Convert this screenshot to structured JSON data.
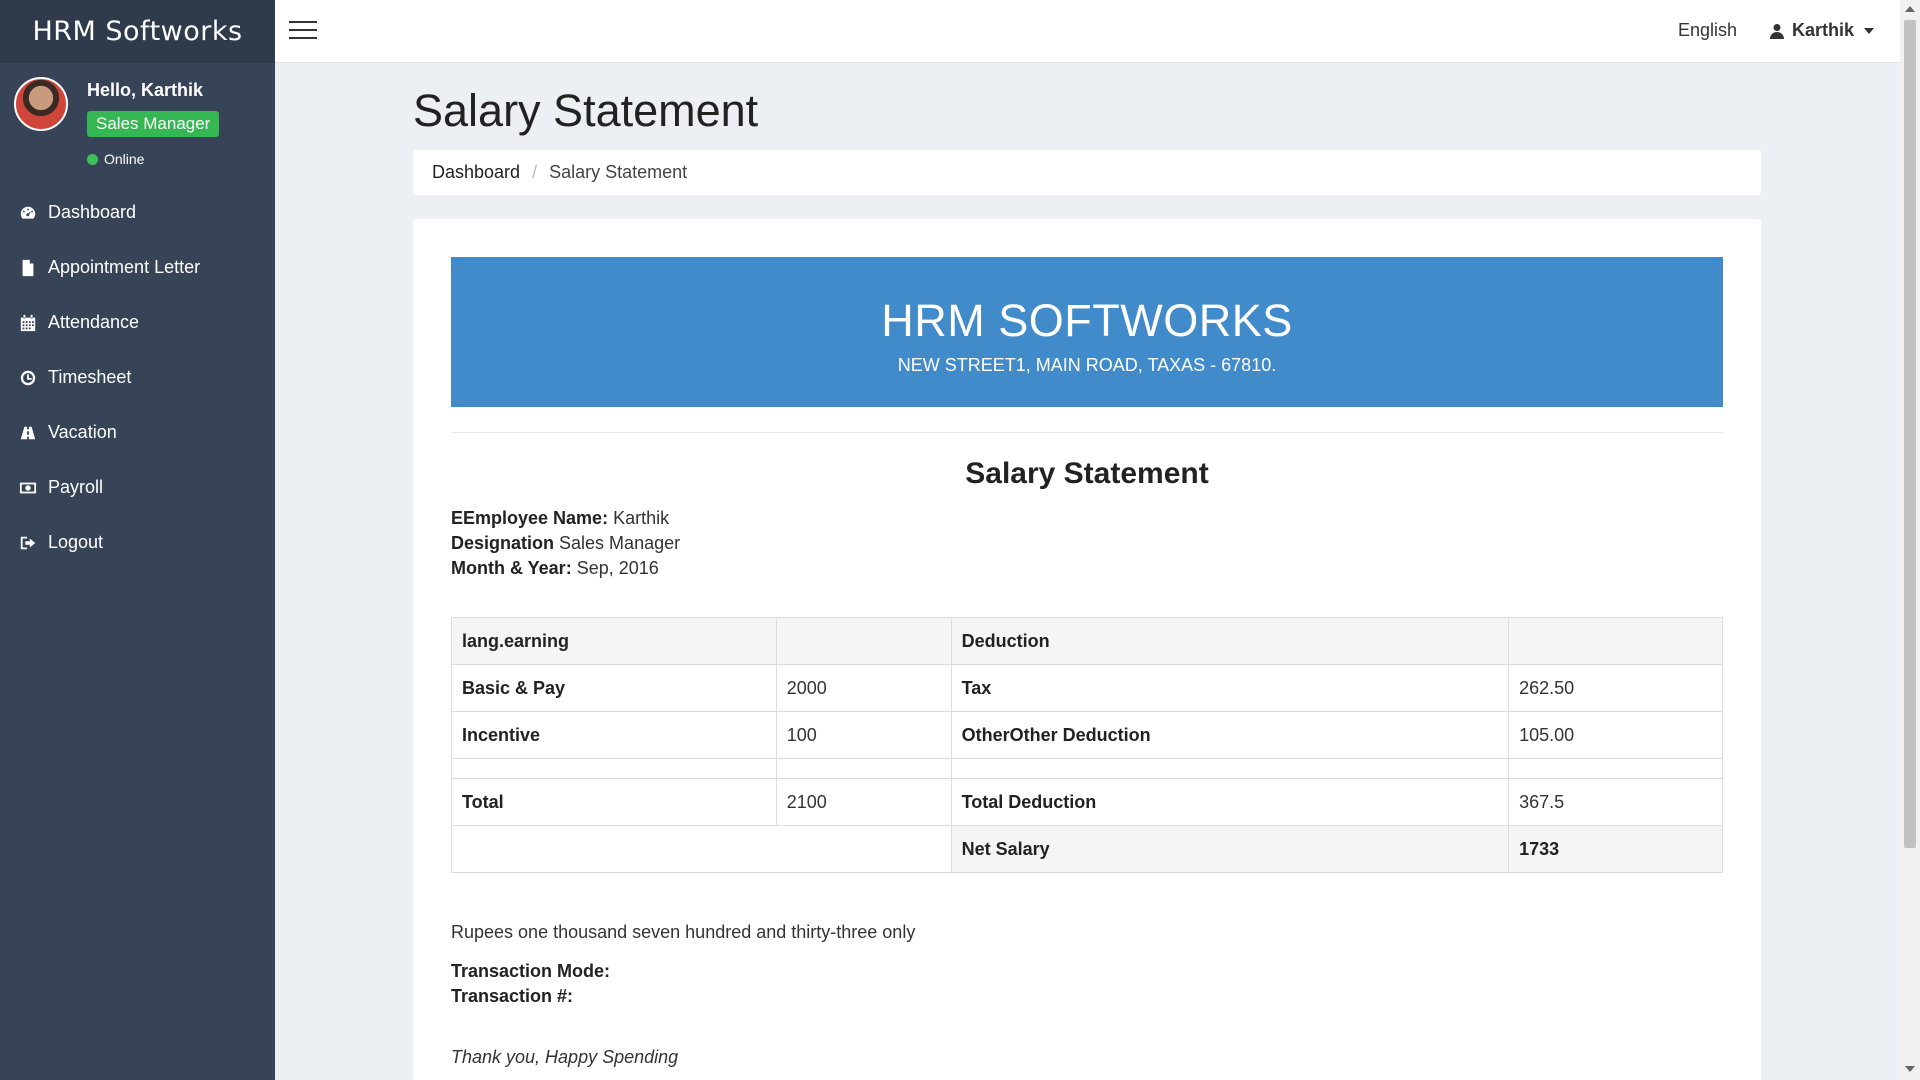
{
  "app": {
    "brand": "HRM Softworks"
  },
  "user_panel": {
    "greeting": "Hello, Karthik",
    "role": "Sales Manager",
    "status": "Online"
  },
  "sidebar": {
    "items": [
      {
        "label": "Dashboard",
        "icon": "dashboard-icon"
      },
      {
        "label": "Appointment Letter",
        "icon": "file-icon"
      },
      {
        "label": "Attendance",
        "icon": "calendar-icon"
      },
      {
        "label": "Timesheet",
        "icon": "clock-icon"
      },
      {
        "label": "Vacation",
        "icon": "road-icon"
      },
      {
        "label": "Payroll",
        "icon": "money-icon"
      },
      {
        "label": "Logout",
        "icon": "logout-icon"
      }
    ]
  },
  "topbar": {
    "language": "English",
    "user_name": "Karthik"
  },
  "page": {
    "title": "Salary Statement",
    "breadcrumb": [
      "Dashboard",
      "Salary Statement"
    ]
  },
  "statement": {
    "company_name": "HRM SOFTWORKS",
    "company_address": "NEW STREET1, MAIN ROAD, TAXAS - 67810.",
    "heading": "Salary Statement",
    "employee_label": "EEmployee Name:",
    "employee_value": "Karthik",
    "designation_label": "Designation",
    "designation_value": "Sales Manager",
    "period_label": "Month & Year:",
    "period_value": "Sep, 2016",
    "table": {
      "earning_header": "lang.earning",
      "deduction_header": "Deduction",
      "rows": [
        {
          "earning": "Basic & Pay",
          "earning_amount": "2000",
          "deduction": "Tax",
          "deduction_amount": "262.50"
        },
        {
          "earning": "Incentive",
          "earning_amount": "100",
          "deduction": "OtherOther Deduction",
          "deduction_amount": "105.00"
        }
      ],
      "total_label": "Total",
      "total_value": "2100",
      "total_deduction_label": "Total Deduction",
      "total_deduction_value": "367.5",
      "net_salary_label": "Net Salary",
      "net_salary_value": "1733"
    },
    "amount_in_words": "Rupees one thousand seven hundred and thirty-three only",
    "transaction_mode_label": "Transaction Mode:",
    "transaction_no_label": "Transaction #:",
    "thanks": "Thank you, Happy Spending"
  }
}
